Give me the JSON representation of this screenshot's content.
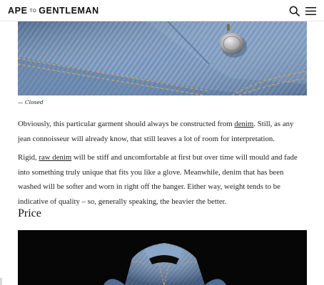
{
  "header": {
    "logo_left": "APE",
    "logo_mid": "TO",
    "logo_right": "GENTLEMAN"
  },
  "figure": {
    "caption": "— Closed"
  },
  "article": {
    "p1": {
      "before": "Obviously, this particular garment should always be constructed from ",
      "link": "denim",
      "after": ". Still, as any jean connoisseur will already know, that still leaves a lot of room for interpretation."
    },
    "p2": {
      "before": "Rigid, ",
      "link": "raw denim",
      "after": " will be stiff and uncomfortable at first but over time will mould and fade into something truly unique that fits you like a glove. Meanwhile, denim that has been washed will be softer and worn in right off the hanger. Either way, weight tends to be indicative of quality – so, generally speaking, the heavier the better."
    },
    "heading": "Price"
  },
  "icons": {
    "search": "search-icon",
    "menu": "hamburger-menu-icon"
  }
}
